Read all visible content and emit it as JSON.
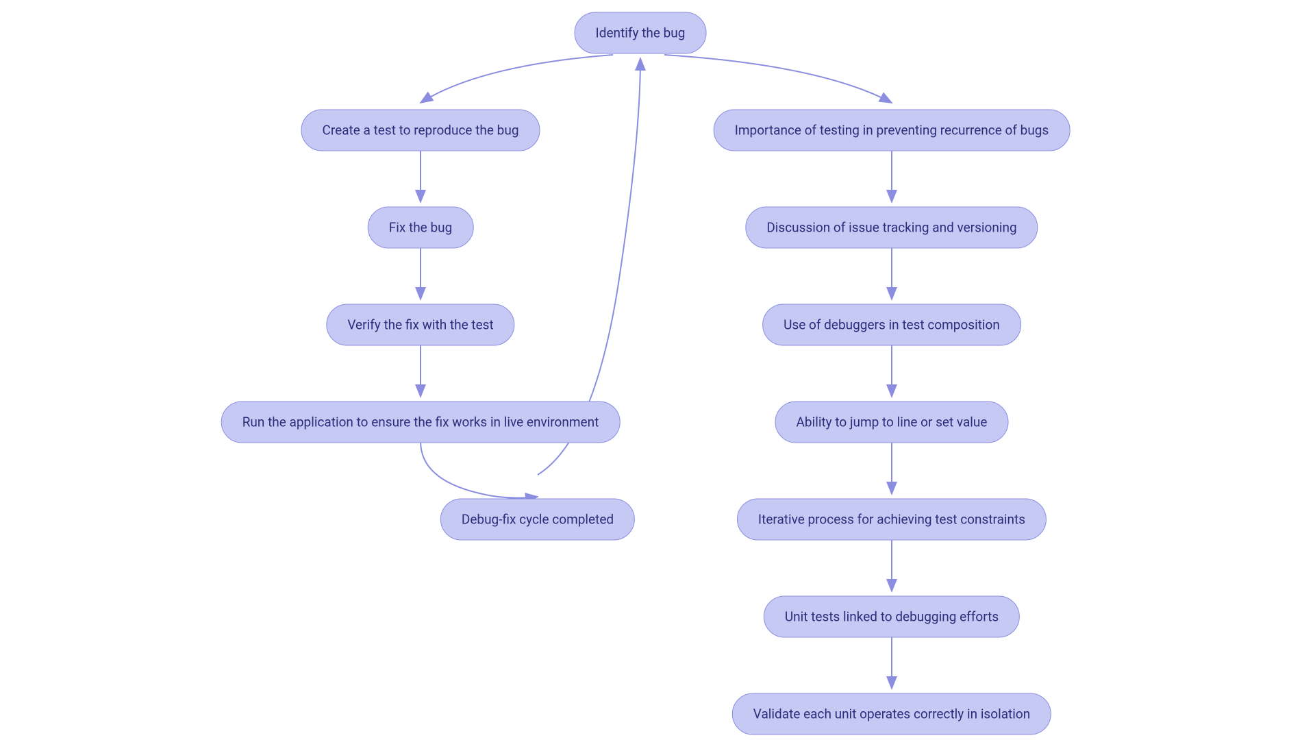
{
  "nodes": {
    "root": "Identify the bug",
    "left1": "Create a test to reproduce the bug",
    "left2": "Fix the bug",
    "left3": "Verify the fix with the test",
    "left4": "Run the application to ensure the fix works in live environment",
    "left5": "Debug-fix cycle completed",
    "right1": "Importance of testing in preventing recurrence of bugs",
    "right2": "Discussion of issue tracking and versioning",
    "right3": "Use of debuggers in test composition",
    "right4": "Ability to jump to line or set value",
    "right5": "Iterative process for achieving test constraints",
    "right6": "Unit tests linked to debugging efforts",
    "right7": "Validate each unit operates correctly in isolation"
  },
  "colors": {
    "node_fill": "#c7c9f5",
    "node_border": "#8b8ee0",
    "text": "#2a2d7a",
    "edge": "#8b8ee0"
  }
}
